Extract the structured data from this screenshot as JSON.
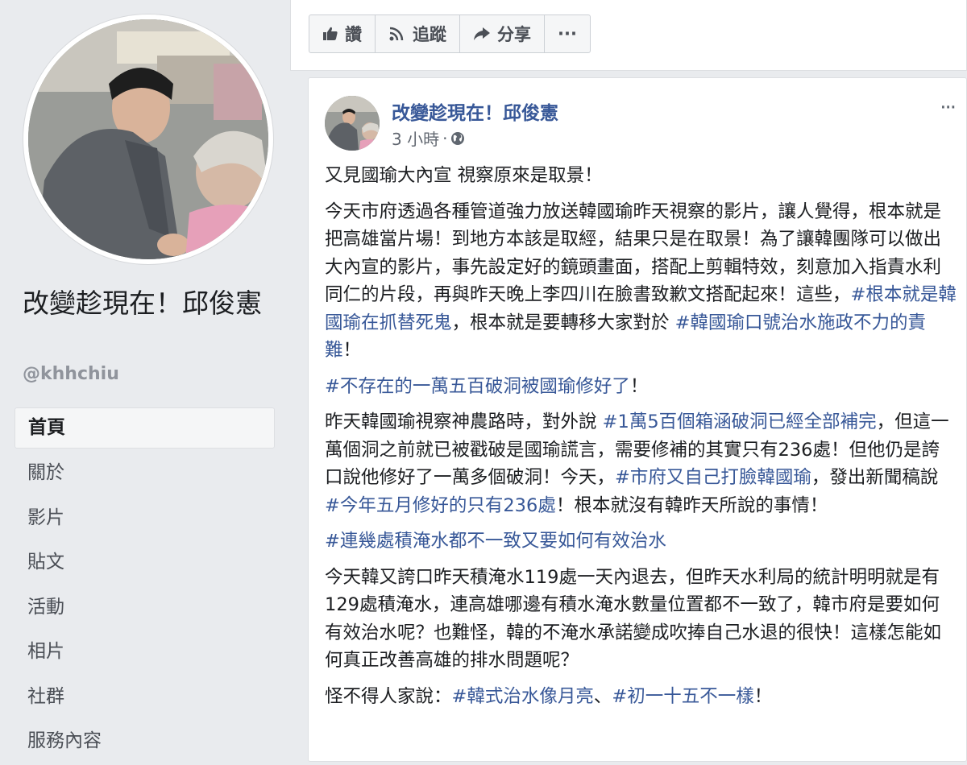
{
  "page": {
    "name": "改變趁現在！邱俊憲",
    "handle": "@khhchiu"
  },
  "nav": {
    "items": [
      {
        "label": "首頁"
      },
      {
        "label": "關於"
      },
      {
        "label": "影片"
      },
      {
        "label": "貼文"
      },
      {
        "label": "活動"
      },
      {
        "label": "相片"
      },
      {
        "label": "社群"
      },
      {
        "label": "服務內容"
      }
    ]
  },
  "actions": {
    "like": "讚",
    "follow": "追蹤",
    "share": "分享",
    "more": "···"
  },
  "post": {
    "author": "改變趁現在！邱俊憲",
    "time": "3 小時",
    "separator": "·",
    "p1": "又見國瑜大內宣 視察原來是取景！",
    "p2a": "今天市府透過各種管道強力放送韓國瑜昨天視察的影片，讓人覺得，根本就是把高雄當片場！到地方本該是取經，結果只是在取景！為了讓韓團隊可以做出大內宣的影片，事先設定好的鏡頭畫面，搭配上剪輯特效，刻意加入指責水利同仁的片段，再與昨天晚上李四川在臉書致歉文搭配起來！這些，",
    "p2tag1": "#根本就是韓國瑜在抓替死鬼",
    "p2b": "，根本就是要轉移大家對於 ",
    "p2tag2": "#韓國瑜口號治水施政不力的責難",
    "p2c": "！",
    "p3tag": "#不存在的一萬五百破洞被國瑜修好了",
    "p3b": "！",
    "p4a": "昨天韓國瑜視察神農路時，對外說 ",
    "p4tag1": "#1萬5百個箱涵破洞已經全部補完",
    "p4b": "，但這一萬個洞之前就已被戳破是國瑜謊言，需要修補的其實只有236處！但他仍是誇口說他修好了一萬多個破洞！今天，",
    "p4tag2": "#市府又自己打臉韓國瑜",
    "p4c": "，發出新聞稿說 ",
    "p4tag3": "#今年五月修好的只有236處",
    "p4d": "！根本就沒有韓昨天所說的事情！",
    "p5tag": "#連幾處積淹水都不一致又要如何有效治水",
    "p6": "今天韓又誇口昨天積淹水119處一天內退去，但昨天水利局的統計明明就是有129處積淹水，連高雄哪邊有積水淹水數量位置都不一致了，韓市府是要如何有效治水呢？也難怪，韓的不淹水承諾變成吹捧自己水退的很快！這樣怎能如何真正改善高雄的排水問題呢？",
    "p7a": "怪不得人家說：",
    "p7tag1": "#韓式治水像月亮",
    "p7b": "、",
    "p7tag2": "#初一十五不一樣",
    "p7c": "！"
  },
  "colors": {
    "link": "#385898",
    "background": "#e9ebee"
  },
  "icons": {
    "like": "thumbs-up-icon",
    "follow": "rss-icon",
    "share": "share-arrow-icon",
    "audience": "globe-icon",
    "more": "more-dots-icon"
  }
}
